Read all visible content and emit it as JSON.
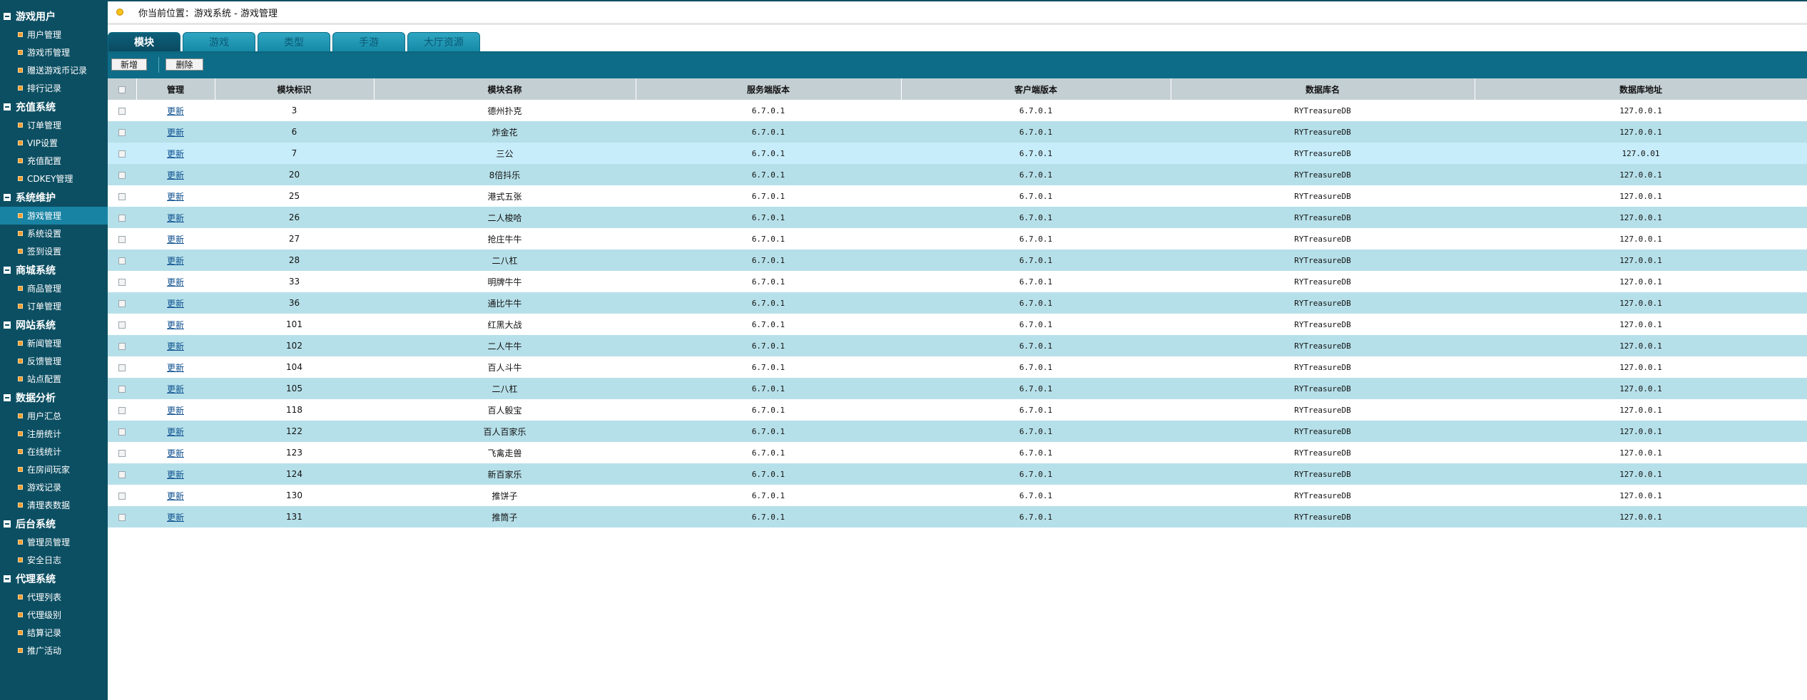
{
  "sidebar": {
    "groups": [
      {
        "title": "游戏用户",
        "items": [
          "用户管理",
          "游戏币管理",
          "赠送游戏币记录",
          "排行记录"
        ]
      },
      {
        "title": "充值系统",
        "items": [
          "订单管理",
          "VIP设置",
          "充值配置",
          "CDKEY管理"
        ]
      },
      {
        "title": "系统维护",
        "items": [
          "游戏管理",
          "系统设置",
          "签到设置"
        ]
      },
      {
        "title": "商城系统",
        "items": [
          "商品管理",
          "订单管理"
        ]
      },
      {
        "title": "网站系统",
        "items": [
          "新闻管理",
          "反馈管理",
          "站点配置"
        ]
      },
      {
        "title": "数据分析",
        "items": [
          "用户汇总",
          "注册统计",
          "在线统计",
          "在房间玩家",
          "游戏记录",
          "清理表数据"
        ]
      },
      {
        "title": "后台系统",
        "items": [
          "管理员管理",
          "安全日志"
        ]
      },
      {
        "title": "代理系统",
        "items": [
          "代理列表",
          "代理级别",
          "结算记录",
          "推广活动"
        ]
      }
    ],
    "active_item": "游戏管理"
  },
  "breadcrumb": {
    "text": "你当前位置：游戏系统 - 游戏管理"
  },
  "tabs": [
    "模块",
    "游戏",
    "类型",
    "手游",
    "大厅资源"
  ],
  "active_tab": "模块",
  "toolbar": {
    "add_label": "新增",
    "delete_label": "删除"
  },
  "table": {
    "columns": [
      "管理",
      "模块标识",
      "模块名称",
      "服务端版本",
      "客户端版本",
      "数据库名",
      "数据库地址"
    ],
    "action_label": "更新",
    "rows": [
      {
        "id": "3",
        "name": "德州扑克",
        "server": "6.7.0.1",
        "client": "6.7.0.1",
        "db": "RYTreasureDB",
        "addr": "127.0.0.1"
      },
      {
        "id": "6",
        "name": "炸金花",
        "server": "6.7.0.1",
        "client": "6.7.0.1",
        "db": "RYTreasureDB",
        "addr": "127.0.0.1"
      },
      {
        "id": "7",
        "name": "三公",
        "server": "6.7.0.1",
        "client": "6.7.0.1",
        "db": "RYTreasureDB",
        "addr": "127.0.01"
      },
      {
        "id": "20",
        "name": "8倍抖乐",
        "server": "6.7.0.1",
        "client": "6.7.0.1",
        "db": "RYTreasureDB",
        "addr": "127.0.0.1"
      },
      {
        "id": "25",
        "name": "港式五张",
        "server": "6.7.0.1",
        "client": "6.7.0.1",
        "db": "RYTreasureDB",
        "addr": "127.0.0.1"
      },
      {
        "id": "26",
        "name": "二人梭哈",
        "server": "6.7.0.1",
        "client": "6.7.0.1",
        "db": "RYTreasureDB",
        "addr": "127.0.0.1"
      },
      {
        "id": "27",
        "name": "抢庄牛牛",
        "server": "6.7.0.1",
        "client": "6.7.0.1",
        "db": "RYTreasureDB",
        "addr": "127.0.0.1"
      },
      {
        "id": "28",
        "name": "二八杠",
        "server": "6.7.0.1",
        "client": "6.7.0.1",
        "db": "RYTreasureDB",
        "addr": "127.0.0.1"
      },
      {
        "id": "33",
        "name": "明牌牛牛",
        "server": "6.7.0.1",
        "client": "6.7.0.1",
        "db": "RYTreasureDB",
        "addr": "127.0.0.1"
      },
      {
        "id": "36",
        "name": "通比牛牛",
        "server": "6.7.0.1",
        "client": "6.7.0.1",
        "db": "RYTreasureDB",
        "addr": "127.0.0.1"
      },
      {
        "id": "101",
        "name": "红黑大战",
        "server": "6.7.0.1",
        "client": "6.7.0.1",
        "db": "RYTreasureDB",
        "addr": "127.0.0.1"
      },
      {
        "id": "102",
        "name": "二人牛牛",
        "server": "6.7.0.1",
        "client": "6.7.0.1",
        "db": "RYTreasureDB",
        "addr": "127.0.0.1"
      },
      {
        "id": "104",
        "name": "百人斗牛",
        "server": "6.7.0.1",
        "client": "6.7.0.1",
        "db": "RYTreasureDB",
        "addr": "127.0.0.1"
      },
      {
        "id": "105",
        "name": "二八杠",
        "server": "6.7.0.1",
        "client": "6.7.0.1",
        "db": "RYTreasureDB",
        "addr": "127.0.0.1"
      },
      {
        "id": "118",
        "name": "百人骰宝",
        "server": "6.7.0.1",
        "client": "6.7.0.1",
        "db": "RYTreasureDB",
        "addr": "127.0.0.1"
      },
      {
        "id": "122",
        "name": "百人百家乐",
        "server": "6.7.0.1",
        "client": "6.7.0.1",
        "db": "RYTreasureDB",
        "addr": "127.0.0.1"
      },
      {
        "id": "123",
        "name": "飞禽走兽",
        "server": "6.7.0.1",
        "client": "6.7.0.1",
        "db": "RYTreasureDB",
        "addr": "127.0.0.1"
      },
      {
        "id": "124",
        "name": "新百家乐",
        "server": "6.7.0.1",
        "client": "6.7.0.1",
        "db": "RYTreasureDB",
        "addr": "127.0.0.1"
      },
      {
        "id": "130",
        "name": "推饼子",
        "server": "6.7.0.1",
        "client": "6.7.0.1",
        "db": "RYTreasureDB",
        "addr": "127.0.0.1"
      },
      {
        "id": "131",
        "name": "推筒子",
        "server": "6.7.0.1",
        "client": "6.7.0.1",
        "db": "RYTreasureDB",
        "addr": "127.0.0.1"
      }
    ]
  },
  "colors": {
    "sidebar": "#0c4f63",
    "active_item": "#1883a3",
    "row_alt": "#b6e0e9",
    "row_highlight": "#c7ecfa",
    "header": "#c4cfd3"
  }
}
